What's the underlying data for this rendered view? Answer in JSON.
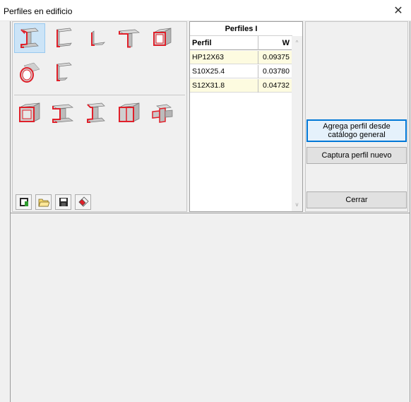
{
  "window": {
    "title": "Perfiles en edificio",
    "close_glyph": "✕"
  },
  "shape_palette": {
    "group1": [
      {
        "icon": "i-beam-icon",
        "selected": true
      },
      {
        "icon": "channel-icon"
      },
      {
        "icon": "angle-icon"
      },
      {
        "icon": "tee-icon"
      },
      {
        "icon": "rectangular-tube-icon"
      },
      {
        "icon": "round-tube-icon"
      },
      {
        "icon": "z-section-icon"
      }
    ],
    "group2": [
      {
        "icon": "box-section-icon"
      },
      {
        "icon": "built-up-i-icon"
      },
      {
        "icon": "double-angle-icon"
      },
      {
        "icon": "double-channel-box-icon"
      },
      {
        "icon": "cross-section-icon"
      }
    ]
  },
  "toolbar": [
    {
      "icon": "new-file-icon"
    },
    {
      "icon": "open-folder-icon"
    },
    {
      "icon": "save-icon"
    },
    {
      "icon": "eraser-icon"
    }
  ],
  "table": {
    "title": "Perfiles I",
    "columns": [
      "Perfil",
      "W"
    ],
    "rows": [
      {
        "perfil": "HP12X63",
        "w": "0.09375"
      },
      {
        "perfil": "S10X25.4",
        "w": "0.03780"
      },
      {
        "perfil": "S12X31.8",
        "w": "0.04732"
      }
    ],
    "scroll_up": "^",
    "scroll_down": "v"
  },
  "buttons": {
    "add_from_catalog": "Agrega perfil desde catálogo general",
    "capture_new": "Captura perfil nuevo",
    "close": "Cerrar"
  },
  "colors": {
    "accent": "#0078d7",
    "profile_edge": "#e0202a",
    "selected_bg": "#cce4f7",
    "row_highlight": "#fdfbe0"
  }
}
